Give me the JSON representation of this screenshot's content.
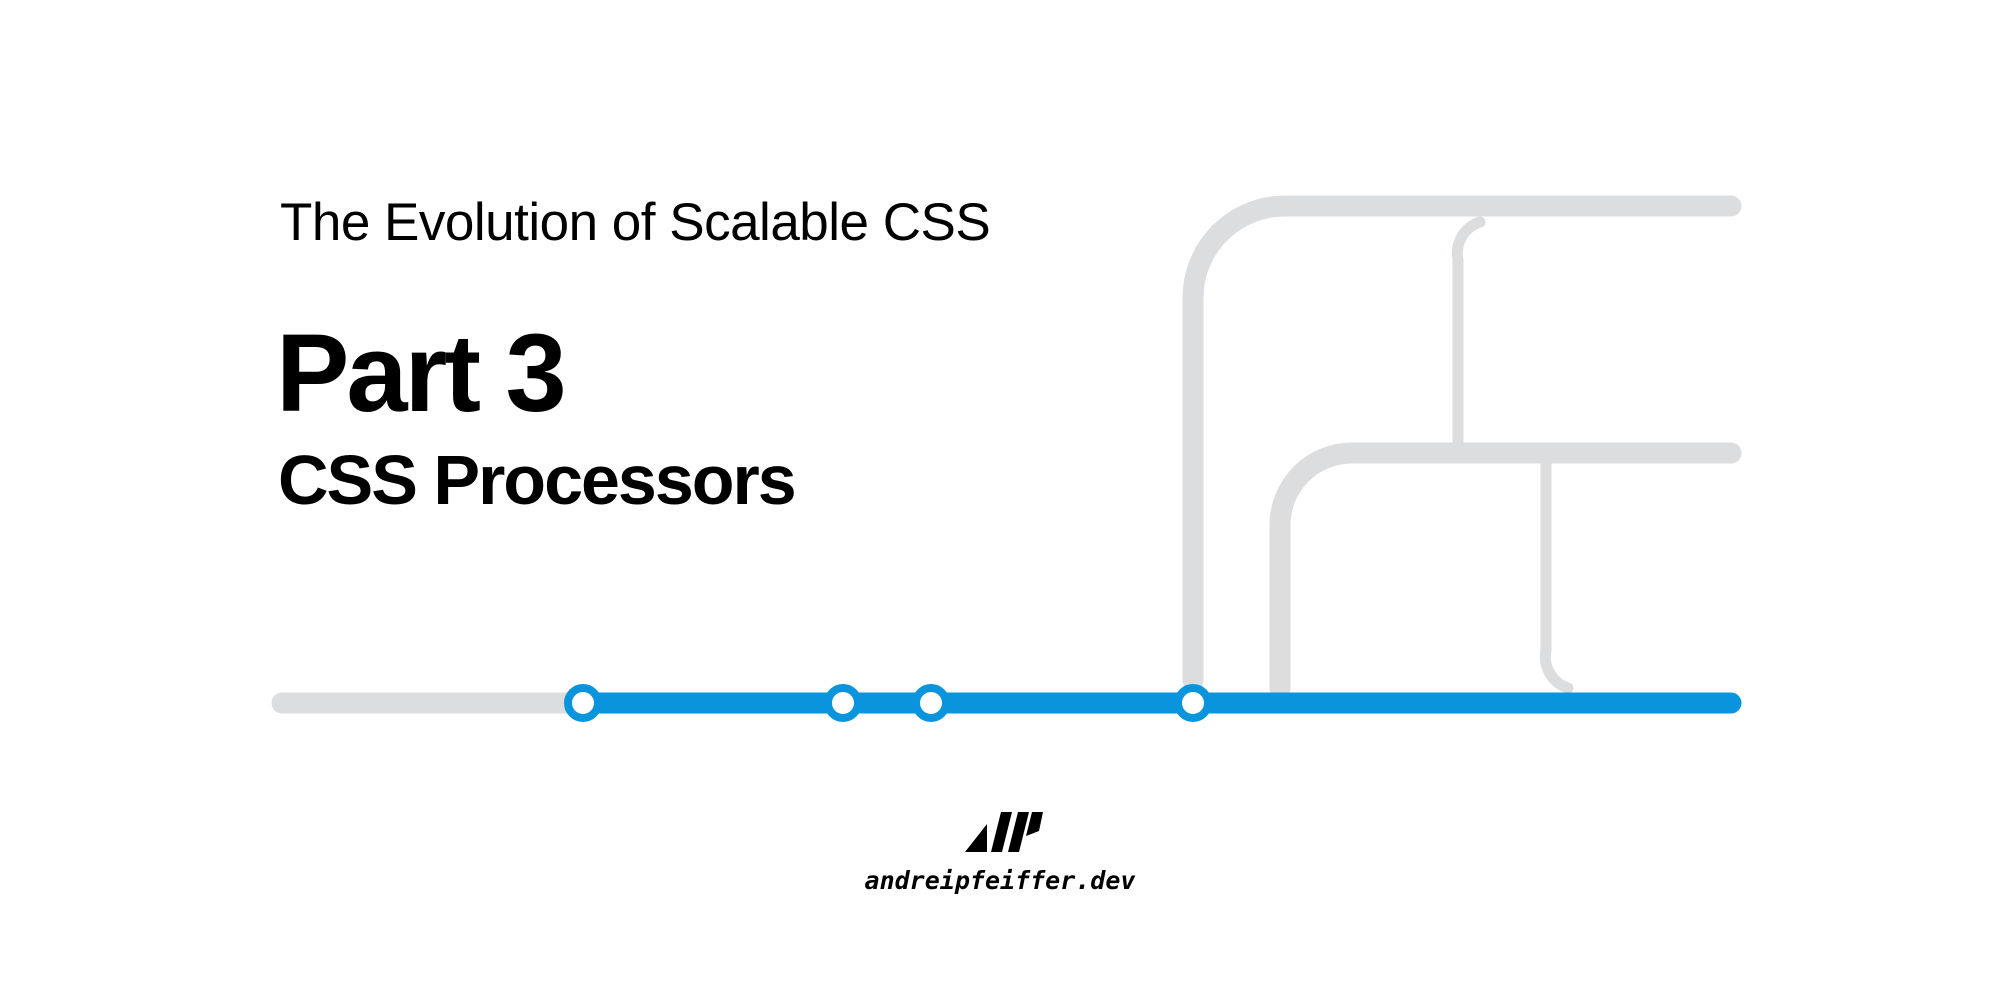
{
  "slide": {
    "series_title": "The Evolution of Scalable CSS",
    "part_label": "Part 3",
    "topic_title": "CSS Processors",
    "site_url": "andreipfeiffer.dev"
  },
  "metro_map": {
    "active_color": "#0994DC",
    "inactive_color": "#DCDDDF",
    "station_fill": "#FFFFFF",
    "station_count": 4
  },
  "branding": {
    "logo": "ap-slanted-stripes-logo",
    "logo_color": "#000000"
  }
}
